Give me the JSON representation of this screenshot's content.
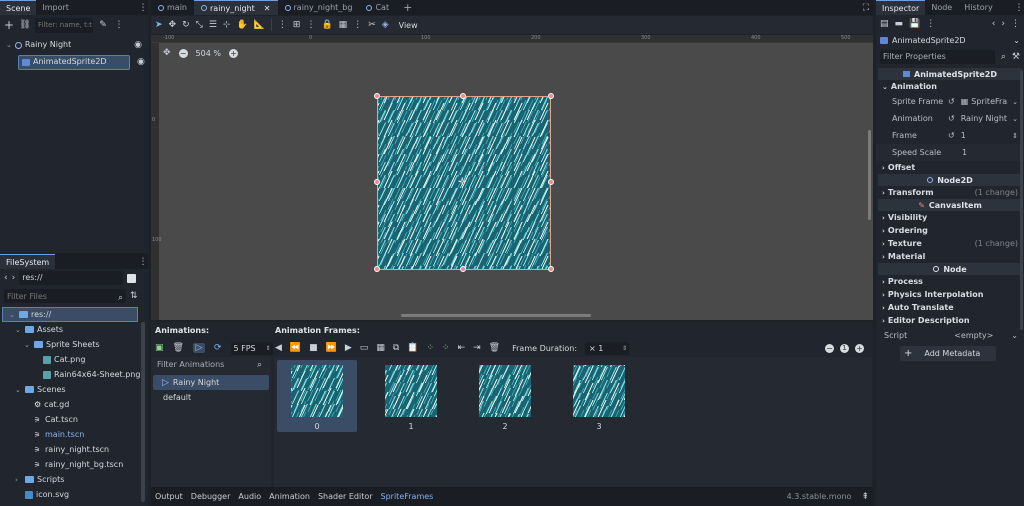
{
  "scene_dock": {
    "tabs": [
      "Scene",
      "Import"
    ],
    "filter_placeholder": "Filter: name, t:t",
    "tree": [
      {
        "label": "Rainy Night",
        "icon": "node2d-icon"
      },
      {
        "label": "AnimatedSprite2D",
        "icon": "animatedsprite-icon"
      }
    ]
  },
  "filesystem": {
    "tab": "FileSystem",
    "path": "res://",
    "filter_placeholder": "Filter Files",
    "items": [
      {
        "label": "res://",
        "type": "folder",
        "indent": 0
      },
      {
        "label": "Assets",
        "type": "folder",
        "indent": 1
      },
      {
        "label": "Sprite Sheets",
        "type": "folder",
        "indent": 2
      },
      {
        "label": "Cat.png",
        "type": "image",
        "indent": 3
      },
      {
        "label": "Rain64x64-Sheet.png",
        "type": "image",
        "indent": 3
      },
      {
        "label": "Scenes",
        "type": "folder",
        "indent": 1
      },
      {
        "label": "cat.gd",
        "type": "script",
        "indent": 2
      },
      {
        "label": "Cat.tscn",
        "type": "scene",
        "indent": 2
      },
      {
        "label": "main.tscn",
        "type": "scene",
        "indent": 2
      },
      {
        "label": "rainy_night.tscn",
        "type": "scene",
        "indent": 2
      },
      {
        "label": "rainy_night_bg.tscn",
        "type": "scene",
        "indent": 2
      },
      {
        "label": "Scripts",
        "type": "folder",
        "indent": 1
      },
      {
        "label": "icon.svg",
        "type": "image",
        "indent": 1
      }
    ]
  },
  "editor_tabs": [
    {
      "label": "main"
    },
    {
      "label": "rainy_night",
      "active": true
    },
    {
      "label": "rainy_night_bg"
    },
    {
      "label": "Cat"
    }
  ],
  "toolbar": {
    "view_label": "View"
  },
  "viewport": {
    "zoom": "504 %",
    "ruler_h": [
      "-100",
      "0",
      "100",
      "200",
      "300",
      "400",
      "500",
      "600"
    ],
    "ruler_v": [
      "0",
      "100"
    ]
  },
  "spriteframes": {
    "animations_label": "Animations:",
    "frames_label": "Animation Frames:",
    "fps": "5 FPS",
    "filter_placeholder": "Filter Animations",
    "animations": [
      "Rainy Night",
      "default"
    ],
    "frame_duration_label": "Frame Duration:",
    "frame_duration": "× 1",
    "frames": [
      "0",
      "1",
      "2",
      "3"
    ]
  },
  "bottom_tabs": [
    "Output",
    "Debugger",
    "Audio",
    "Animation",
    "Shader Editor",
    "SpriteFrames"
  ],
  "version": "4.3.stable.mono",
  "inspector": {
    "tabs": [
      "Inspector",
      "Node",
      "History"
    ],
    "node_name": "AnimatedSprite2D",
    "filter_placeholder": "Filter Properties",
    "class_header": "AnimatedSprite2D",
    "animation_section": "Animation",
    "props": [
      {
        "label": "Sprite Frame",
        "value": "SpriteFra"
      },
      {
        "label": "Animation",
        "value": "Rainy Night"
      },
      {
        "label": "Frame",
        "value": "1"
      },
      {
        "label": "Speed Scale",
        "value": "1"
      }
    ],
    "offset_section": "Offset",
    "node2d_header": "Node2D",
    "transform_section": "Transform",
    "transform_change": "(1 change)",
    "canvasitem_header": "CanvasItem",
    "visibility_section": "Visibility",
    "ordering_section": "Ordering",
    "texture_section": "Texture",
    "texture_change": "(1 change)",
    "material_section": "Material",
    "node_header": "Node",
    "process_section": "Process",
    "physics_section": "Physics Interpolation",
    "autotranslate_section": "Auto Translate",
    "editordesc_section": "Editor Description",
    "script_label": "Script",
    "script_value": "<empty>",
    "add_metadata": "Add Metadata"
  },
  "colors": {
    "accent": "#70a0e0",
    "selection": "#3a4c66",
    "rain_bg": "#1b6370"
  }
}
